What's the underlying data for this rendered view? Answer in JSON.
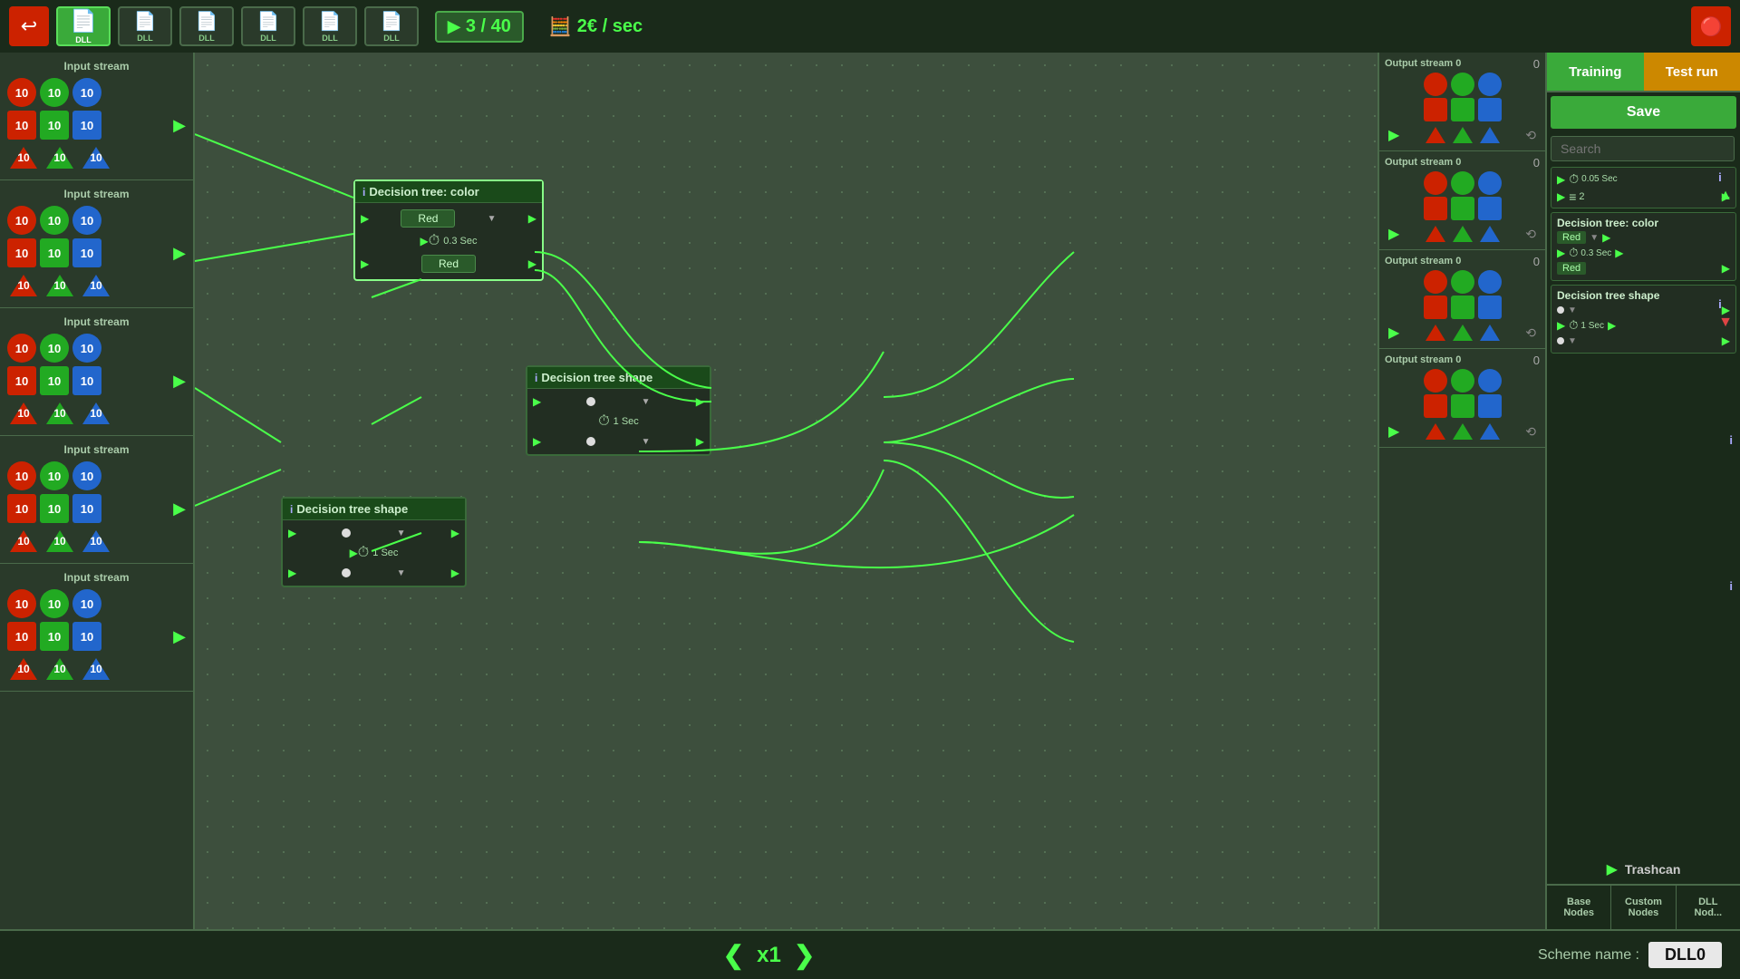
{
  "topbar": {
    "back_label": "↩",
    "dll_buttons": [
      {
        "label": "DLL",
        "active": true
      },
      {
        "label": "DLL",
        "active": false
      },
      {
        "label": "DLL",
        "active": false
      },
      {
        "label": "DLL",
        "active": false
      },
      {
        "label": "DLL",
        "active": false
      },
      {
        "label": "DLL",
        "active": false
      }
    ],
    "play_label": "▶",
    "counter": "3 / 40",
    "rate": "2€ / sec",
    "top_right": "🔴"
  },
  "left_streams": [
    {
      "title": "Input stream",
      "rows": [
        {
          "circles": [
            "10",
            "10",
            "10"
          ],
          "colors": [
            "red",
            "green",
            "blue"
          ]
        },
        {
          "squares": [
            "10",
            "10",
            "10"
          ],
          "colors": [
            "red",
            "green",
            "blue"
          ]
        },
        {
          "triangles": [
            "10",
            "10",
            "10"
          ],
          "colors": [
            "red",
            "green",
            "blue"
          ]
        }
      ]
    },
    {
      "title": "Input stream",
      "rows": [
        {
          "circles": [
            "10",
            "10",
            "10"
          ],
          "colors": [
            "red",
            "green",
            "blue"
          ]
        },
        {
          "squares": [
            "10",
            "10",
            "10"
          ],
          "colors": [
            "red",
            "green",
            "blue"
          ]
        },
        {
          "triangles": [
            "10",
            "10",
            "10"
          ],
          "colors": [
            "red",
            "green",
            "blue"
          ]
        }
      ]
    },
    {
      "title": "Input stream",
      "rows": [
        {
          "circles": [
            "10",
            "10",
            "10"
          ],
          "colors": [
            "red",
            "green",
            "blue"
          ]
        },
        {
          "squares": [
            "10",
            "10",
            "10"
          ],
          "colors": [
            "red",
            "green",
            "blue"
          ]
        },
        {
          "triangles": [
            "10",
            "10",
            "10"
          ],
          "colors": [
            "red",
            "green",
            "blue"
          ]
        }
      ]
    },
    {
      "title": "Input stream",
      "rows": [
        {
          "circles": [
            "10",
            "10",
            "10"
          ],
          "colors": [
            "red",
            "green",
            "blue"
          ]
        },
        {
          "squares": [
            "10",
            "10",
            "10"
          ],
          "colors": [
            "red",
            "green",
            "blue"
          ]
        },
        {
          "triangles": [
            "10",
            "10",
            "10"
          ],
          "colors": [
            "red",
            "green",
            "blue"
          ]
        }
      ]
    },
    {
      "title": "Input stream",
      "rows": [
        {
          "circles": [
            "10",
            "10",
            "10"
          ],
          "colors": [
            "red",
            "green",
            "blue"
          ]
        },
        {
          "squares": [
            "10",
            "10",
            "10"
          ],
          "colors": [
            "red",
            "green",
            "blue"
          ]
        },
        {
          "triangles": [
            "10",
            "10",
            "10"
          ],
          "colors": [
            "red",
            "green",
            "blue"
          ]
        }
      ]
    }
  ],
  "output_streams": [
    {
      "title": "Output stream 0",
      "count": "0"
    },
    {
      "title": "Output stream 0",
      "count": "0"
    },
    {
      "title": "Output stream 0",
      "count": "0"
    },
    {
      "title": "Output stream 0",
      "count": "0"
    }
  ],
  "nodes": {
    "decision_color": {
      "title": "Decision tree: color",
      "info": "i",
      "value1": "Red",
      "timer": "0.3 Sec",
      "value2": "Red"
    },
    "decision_shape1": {
      "title": "Decision tree shape",
      "info": "i",
      "timer": "1 Sec"
    },
    "decision_shape2": {
      "title": "Decision tree shape",
      "info": "i",
      "timer": "1 Sec"
    }
  },
  "right_panel": {
    "tab_training": "Training",
    "tab_testrun": "Test run",
    "save_label": "Save",
    "search_placeholder": "Search",
    "node_entries": [
      {
        "type": "timing",
        "timer": "0.05 Sec",
        "num": "2"
      },
      {
        "type": "decision_color",
        "title": "Decision tree: color",
        "value1": "Red",
        "timer": "0.3 Sec",
        "value2": "Red"
      },
      {
        "type": "decision_shape",
        "title": "Decision tree shape",
        "timer": "1 Sec"
      }
    ],
    "trashcan_label": "Trashcan",
    "bottom_tabs": [
      "Base\nNodes",
      "Custom\nNodes",
      "DLL\nNodes"
    ]
  },
  "bottom_bar": {
    "speed_left": "❮",
    "speed_value": "x1",
    "speed_right": "❯",
    "scheme_label": "Scheme name :",
    "scheme_name": "DLL0"
  }
}
